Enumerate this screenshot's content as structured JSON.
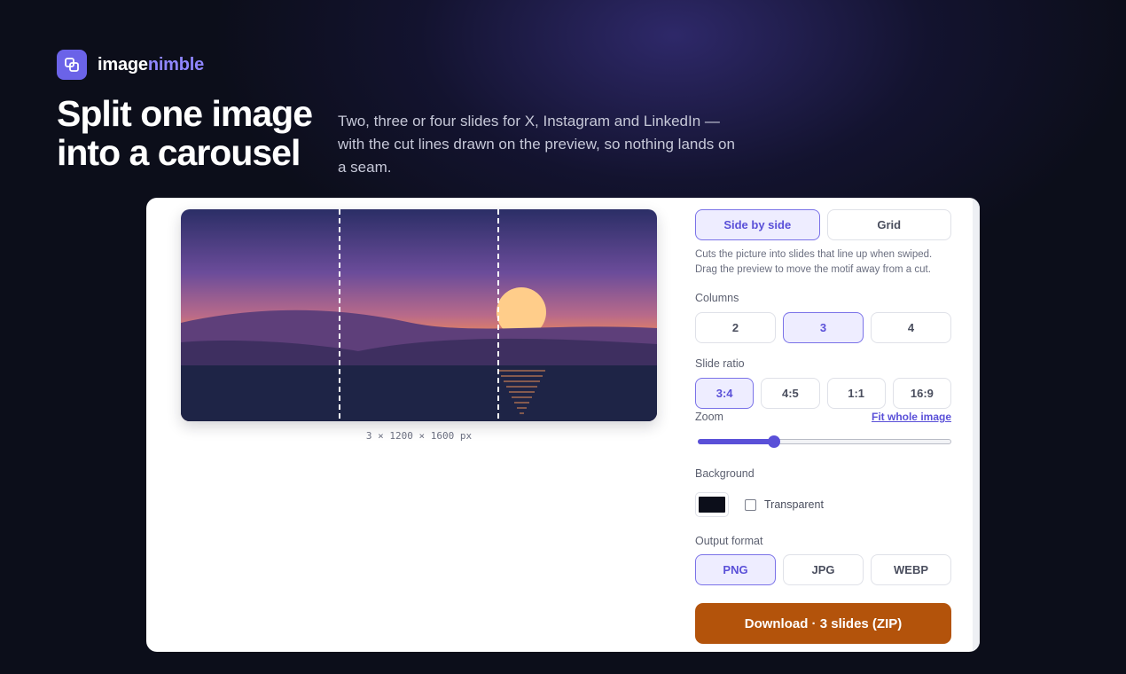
{
  "brand": {
    "name_part1": "image",
    "name_part2": "nimble"
  },
  "hero": {
    "title": "Split one image into a carousel",
    "subtitle": "Two, three or four slides for X, Instagram and LinkedIn — with the cut lines drawn on the preview, so nothing lands on a seam."
  },
  "preview": {
    "dimensions": "3 × 1200 × 1600 px",
    "columns_shown": 3
  },
  "panel": {
    "mode_tabs": [
      {
        "label": "Side by side",
        "active": true
      },
      {
        "label": "Grid",
        "active": false
      }
    ],
    "mode_description": "Cuts the picture into slides that line up when swiped. Drag the preview to move the motif away from a cut.",
    "columns": {
      "label": "Columns",
      "options": [
        {
          "label": "2",
          "active": false
        },
        {
          "label": "3",
          "active": true
        },
        {
          "label": "4",
          "active": false
        }
      ]
    },
    "slide_ratio": {
      "label": "Slide ratio",
      "options": [
        {
          "label": "3:4",
          "active": true
        },
        {
          "label": "4:5",
          "active": false
        },
        {
          "label": "1:1",
          "active": false
        },
        {
          "label": "16:9",
          "active": false
        }
      ]
    },
    "zoom": {
      "label": "Zoom",
      "link": "Fit whole image",
      "value_fraction": 0.3
    },
    "background": {
      "label": "Background",
      "color": "#0c0e1a",
      "transparent_label": "Transparent",
      "transparent_checked": false
    },
    "output_format": {
      "label": "Output format",
      "options": [
        {
          "label": "PNG",
          "active": true
        },
        {
          "label": "JPG",
          "active": false
        },
        {
          "label": "WEBP",
          "active": false
        }
      ]
    },
    "download_label": "Download · 3 slides (ZIP)"
  },
  "colors": {
    "accent": "#5a50d8",
    "brand_accent": "#8f86ff",
    "download": "#b3530b",
    "page_bg": "#0c0e1a"
  },
  "icons": {
    "logo": "layers-icon"
  }
}
